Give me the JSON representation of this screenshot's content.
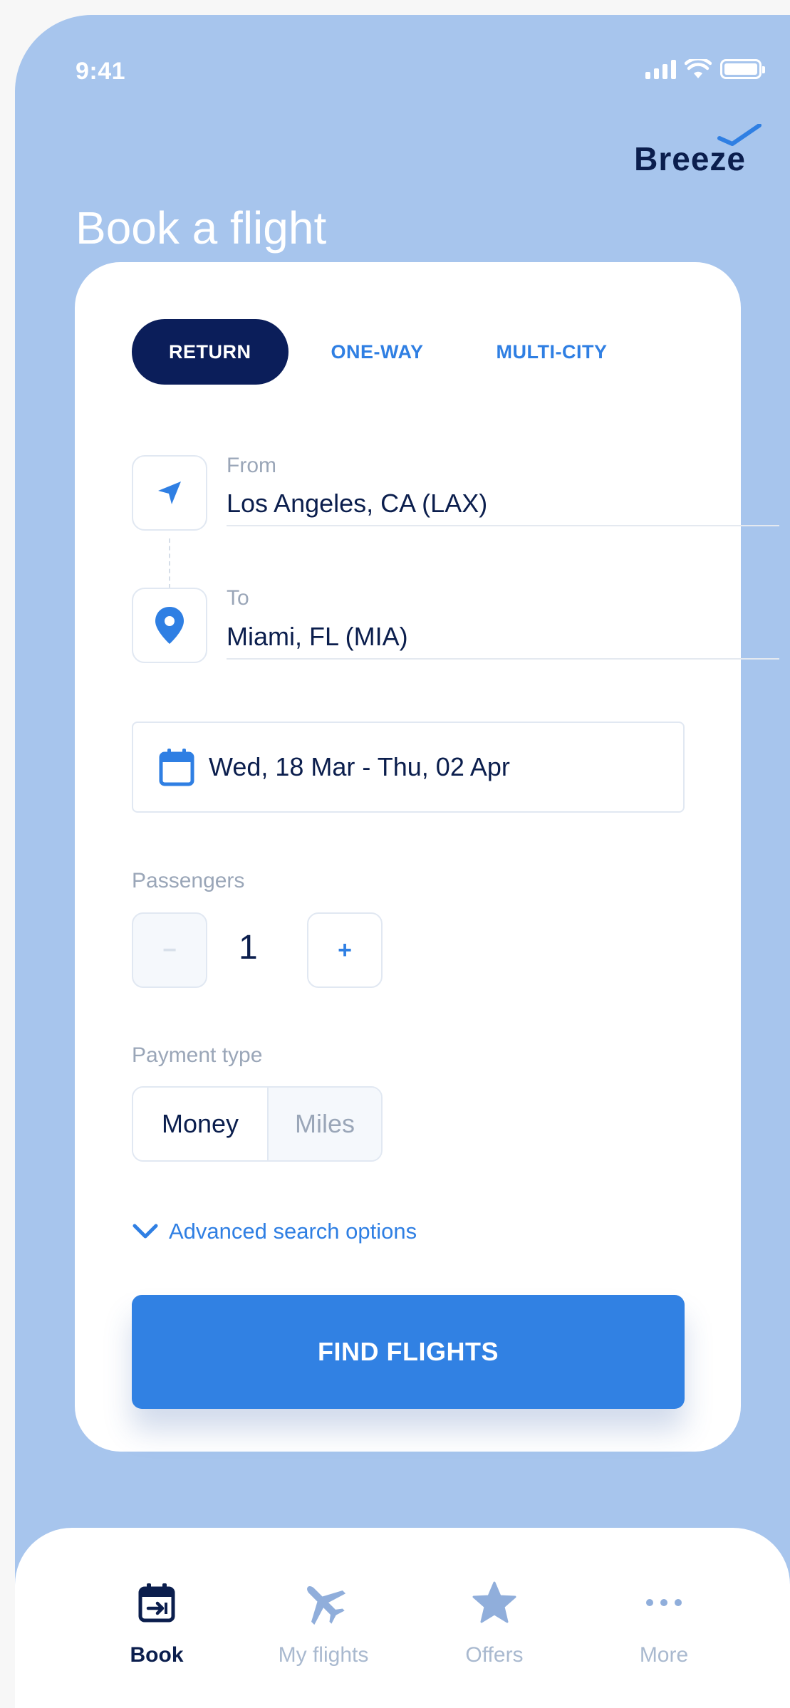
{
  "status_bar": {
    "time": "9:41"
  },
  "brand": {
    "logo_text": "Breeze"
  },
  "page": {
    "title": "Book a flight"
  },
  "trip_tabs": [
    {
      "label": "RETURN",
      "active": true
    },
    {
      "label": "ONE-WAY",
      "active": false
    },
    {
      "label": "MULTI-CITY",
      "active": false
    }
  ],
  "from": {
    "label": "From",
    "value": "Los Angeles, CA (LAX)",
    "icon": "navigation-arrow-icon"
  },
  "to": {
    "label": "To",
    "value": "Miami, FL (MIA)",
    "icon": "map-pin-icon"
  },
  "dates": {
    "value": "Wed, 18 Mar - Thu, 02 Apr",
    "icon": "calendar-icon"
  },
  "passengers": {
    "label": "Passengers",
    "count": "1",
    "minus": "−",
    "plus": "+"
  },
  "payment": {
    "label": "Payment type",
    "options": [
      "Money",
      "Miles"
    ],
    "selected": "Money"
  },
  "advanced": {
    "label": "Advanced search options",
    "icon": "chevron-down-icon"
  },
  "cta": {
    "label": "FIND FLIGHTS"
  },
  "nav": [
    {
      "label": "Book",
      "icon": "calendar-book-icon",
      "active": true
    },
    {
      "label": "My flights",
      "icon": "airplane-icon",
      "active": false
    },
    {
      "label": "Offers",
      "icon": "star-icon",
      "active": false
    },
    {
      "label": "More",
      "icon": "more-dots-icon",
      "active": false
    }
  ],
  "colors": {
    "background": "#a7c5ed",
    "navy": "#0b1e4d",
    "accent": "#3181e3",
    "muted": "#9aa6b8"
  }
}
